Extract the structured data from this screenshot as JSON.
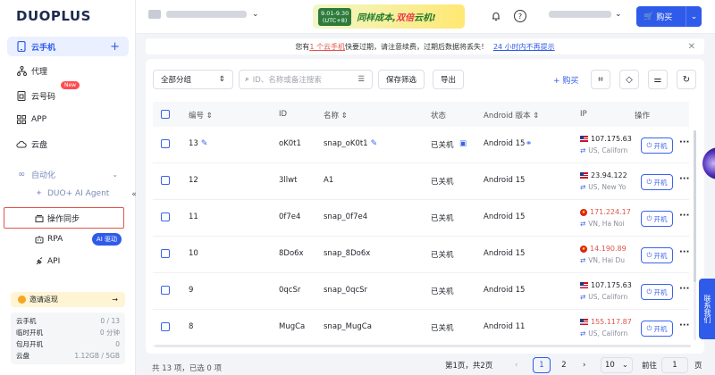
{
  "logo": "DUOPLUS",
  "sidebar": {
    "items": [
      {
        "label": "云手机",
        "plus": "+"
      },
      {
        "label": "代理"
      },
      {
        "label": "云号码",
        "badge": "New"
      },
      {
        "label": "APP"
      },
      {
        "label": "云盘"
      },
      {
        "label": "自动化"
      }
    ],
    "sub": {
      "agent": "DUO+ AI Agent",
      "sync": "操作同步",
      "rpa": "RPA",
      "rpa_tag": "AI 驱动",
      "api": "API"
    },
    "invite": "邀请返现",
    "invite_arrow": "→",
    "stats": [
      {
        "label": "云手机",
        "value": "0 / 13"
      },
      {
        "label": "临时开机",
        "value": "0 分钟"
      },
      {
        "label": "包月开机",
        "value": "0"
      },
      {
        "label": "云盘",
        "value": "1.12GB / 5GB"
      }
    ]
  },
  "topbar": {
    "promo_date": "9.01-9.30",
    "promo_date_sub": "(UTC+8)",
    "promo_text_a": "同样成本,",
    "promo_text_hl": "双倍",
    "promo_text_b": "云机!",
    "buy": "购买"
  },
  "notice": {
    "text_a": "您有",
    "link": "1 个云手机",
    "text_b": "快要过期，请注意续费，过期后数据将丢失！",
    "dismiss": "24 小时内不再提示"
  },
  "toolbar": {
    "group": "全部分组",
    "search_placeholder": "ID、名称或备注搜索",
    "save_filter": "保存筛选",
    "export": "导出",
    "buy": "+ 购买"
  },
  "table": {
    "headers": {
      "num": "编号 ⇕",
      "id": "ID",
      "name": "名称 ⇕",
      "status": "状态",
      "android": "Android 版本 ⇕",
      "ip": "IP",
      "action": "操作"
    },
    "rows": [
      {
        "num": "13",
        "id": "oK0t1",
        "name": "snap_oK0t1",
        "status": "已关机",
        "android": "Android 15",
        "ip": "107.175.63",
        "loc": "US, Californ",
        "flag": "us",
        "red": false
      },
      {
        "num": "12",
        "id": "3llwt",
        "name": "A1",
        "status": "已关机",
        "android": "Android 15",
        "ip": "23.94.122",
        "loc": "US, New Yo",
        "flag": "us",
        "red": false
      },
      {
        "num": "11",
        "id": "0f7e4",
        "name": "snap_0f7e4",
        "status": "已关机",
        "android": "Android 15",
        "ip": "171.224.17",
        "loc": "VN, Ha Noi",
        "flag": "vn",
        "red": true
      },
      {
        "num": "10",
        "id": "8Do6x",
        "name": "snap_8Do6x",
        "status": "已关机",
        "android": "Android 15",
        "ip": "14.190.89",
        "loc": "VN, Hai Du",
        "flag": "vn",
        "red": true
      },
      {
        "num": "9",
        "id": "0qcSr",
        "name": "snap_0qcSr",
        "status": "已关机",
        "android": "Android 15",
        "ip": "107.175.63",
        "loc": "US, Californ",
        "flag": "us",
        "red": false
      },
      {
        "num": "8",
        "id": "MugCa",
        "name": "snap_MugCa",
        "status": "已关机",
        "android": "Android 11",
        "ip": "155.117.87",
        "loc": "US, Californ",
        "flag": "us",
        "red": true
      }
    ],
    "power_label": "开机",
    "more": "···"
  },
  "footer": {
    "total": "共 13 项，已选 0 项",
    "page_info": "第1页，共2页",
    "pages": [
      "1",
      "2"
    ],
    "page_size": "10",
    "goto_label": "前往",
    "goto_value": "1",
    "page_suffix": "页"
  },
  "contact": "联系我们"
}
